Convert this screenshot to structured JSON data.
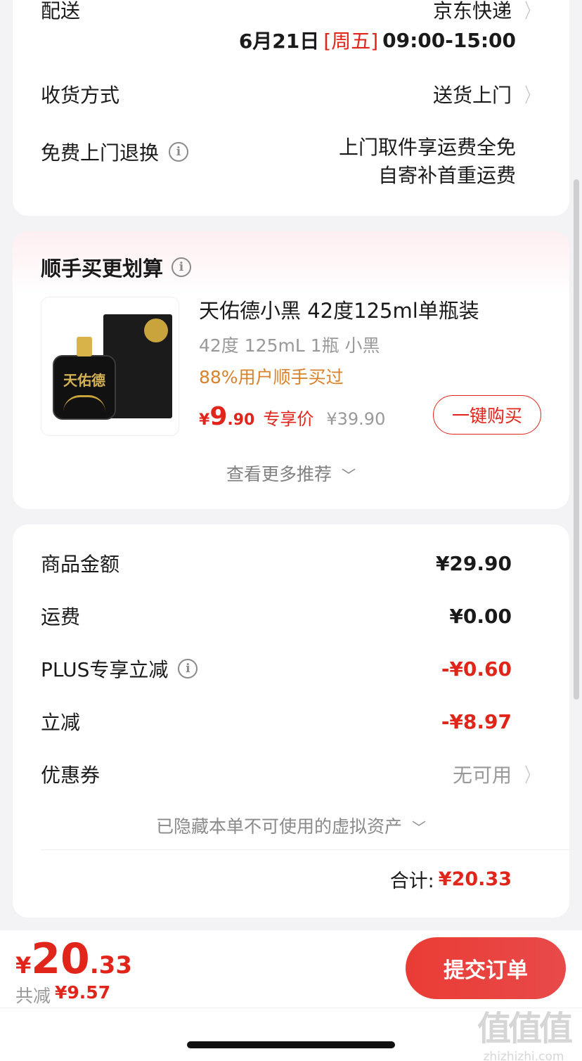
{
  "delivery": {
    "label": "配送",
    "carrier": "京东快递",
    "date_prefix": "6月21日",
    "weekday": "[周五]",
    "time": "09:00-15:00",
    "receive_label": "收货方式",
    "receive_value": "送货上门",
    "return_label": "免费上门退换",
    "return_line1": "上门取件享运费全免",
    "return_line2": "自寄补首重运费"
  },
  "addon": {
    "title": "顺手买更划算",
    "product_name": "天佑德小黑 42度125ml单瓶装",
    "spec": "42度 125mL 1瓶 小黑",
    "bought_note": "88%用户顺手买过",
    "currency": "¥",
    "price_int": "9",
    "price_dec": ".90",
    "price_tag": "专享价",
    "original_price": "¥39.90",
    "buy_button": "一键购买",
    "more": "查看更多推荐",
    "bottle_label": "天佑德"
  },
  "summary": {
    "goods_label": "商品金额",
    "goods_value": "¥29.90",
    "shipping_label": "运费",
    "shipping_value": "¥0.00",
    "plus_label": "PLUS专享立减",
    "plus_value": "-¥0.60",
    "discount_label": "立减",
    "discount_value": "-¥8.97",
    "coupon_label": "优惠券",
    "coupon_value": "无可用",
    "hidden_assets": "已隐藏本单不可使用的虚拟资产",
    "total_label": "合计:",
    "total_value": "¥20.33"
  },
  "footer": {
    "currency": "¥",
    "total_int": "20",
    "total_dec": ".33",
    "saved_label": "共减",
    "saved_value": "¥9.57",
    "submit": "提交订单"
  },
  "watermark": {
    "logo": "值值值",
    "url": "zhizhizhi.com"
  },
  "colors": {
    "accent": "#e1251b",
    "orange": "#d9822b",
    "background": "#f3f3f5"
  }
}
